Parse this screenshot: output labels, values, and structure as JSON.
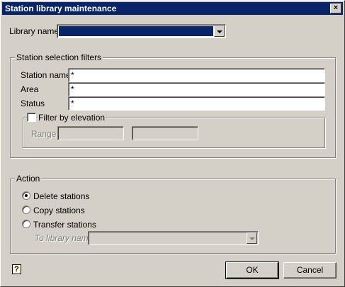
{
  "window": {
    "title": "Station library maintenance",
    "close": "×"
  },
  "library": {
    "label": "Library name",
    "value": ""
  },
  "filters": {
    "legend": "Station selection filters",
    "station_name": {
      "label": "Station name",
      "value": "*"
    },
    "area": {
      "label": "Area",
      "value": "*"
    },
    "status": {
      "label": "Status",
      "value": "*"
    },
    "elevation": {
      "label": "Filter by elevation",
      "checked": false,
      "range_label": "Range",
      "range_from": "",
      "range_to": ""
    }
  },
  "action": {
    "legend": "Action",
    "options": [
      "Delete stations",
      "Copy stations",
      "Transfer stations"
    ],
    "selected": "Delete stations",
    "to_library_label": "To library name",
    "to_library_value": ""
  },
  "buttons": {
    "help": "?",
    "ok": "OK",
    "cancel": "Cancel"
  }
}
